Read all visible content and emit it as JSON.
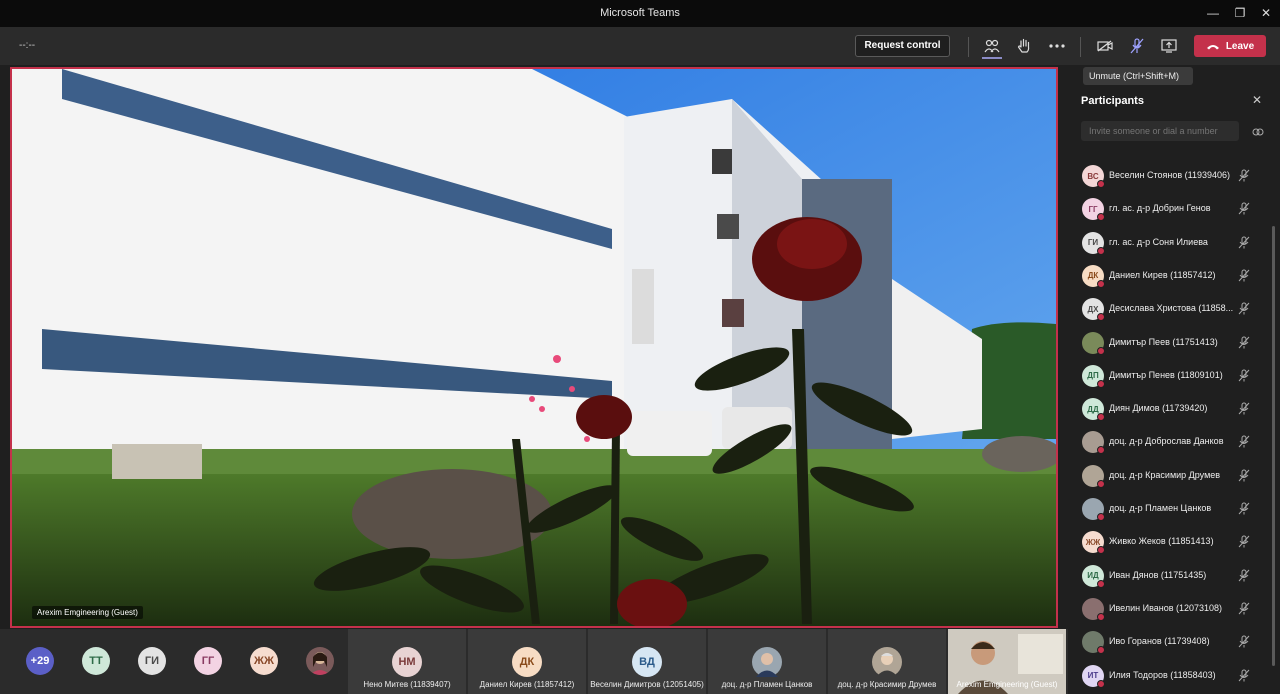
{
  "window": {
    "title": "Microsoft Teams",
    "minimize": "—",
    "maximize": "❐",
    "close": "✕"
  },
  "toolbar": {
    "timer": "--:--",
    "request_control": "Request control",
    "leave": "Leave"
  },
  "tooltip": "Unmute (Ctrl+Shift+M)",
  "video": {
    "label": "Arexim Emgineering (Guest)"
  },
  "bottom": {
    "overflow_count": "+29",
    "small_avatars": [
      {
        "initials": "ТТ",
        "bg": "#cfe8d9",
        "fg": "#2e6b48"
      },
      {
        "initials": "ГИ",
        "bg": "#e3e3e3",
        "fg": "#4a4a4a"
      },
      {
        "initials": "ГГ",
        "bg": "#f3d3e3",
        "fg": "#8a3a62"
      },
      {
        "initials": "ЖЖ",
        "bg": "#f6dccf",
        "fg": "#8a4a2a"
      }
    ],
    "tiles": [
      {
        "initials": "НМ",
        "name": "Нено Митев (11839407)",
        "bg": "#e8d3d3",
        "fg": "#7a3a3a"
      },
      {
        "initials": "ДК",
        "name": "Даниел Кирев (11857412)",
        "bg": "#f7dcc4",
        "fg": "#8a4a1a"
      },
      {
        "initials": "ВД",
        "name": "Веселин Димитров (12051405)",
        "bg": "#d6e6f3",
        "fg": "#2a5a8a"
      },
      {
        "initials": "",
        "name": "доц. д-р Пламен Цанков",
        "bg": "#9aa6b0",
        "fg": "#fff"
      },
      {
        "initials": "",
        "name": "доц. д-р Красимир Друмев",
        "bg": "#b0a596",
        "fg": "#fff"
      }
    ],
    "self_label": "Arexim Emgineering (Guest)"
  },
  "panel": {
    "title": "Participants",
    "invite_placeholder": "Invite someone or dial a number",
    "participants": [
      {
        "initials": "ВС",
        "name": "Веселин Стоянов (11939406)",
        "bg": "#f3d6d6",
        "fg": "#8a3a3a"
      },
      {
        "initials": "ГГ",
        "name": "гл. ас. д-р Добрин Генов",
        "bg": "#f3d3e3",
        "fg": "#8a3a62"
      },
      {
        "initials": "ГИ",
        "name": "гл. ас. д-р Соня Илиева",
        "bg": "#e3e3e3",
        "fg": "#4a4a4a"
      },
      {
        "initials": "ДК",
        "name": "Даниел Кирев (11857412)",
        "bg": "#f7dcc4",
        "fg": "#8a4a1a"
      },
      {
        "initials": "ДХ",
        "name": "Десислава Христова (11858...",
        "bg": "#e3e3e3",
        "fg": "#4a4a4a"
      },
      {
        "initials": "",
        "name": "Димитър Пеев (11751413)",
        "bg": "#7a8a5a",
        "fg": "#fff"
      },
      {
        "initials": "ДП",
        "name": "Димитър Пенев (11809101)",
        "bg": "#cfe8d9",
        "fg": "#2e6b48"
      },
      {
        "initials": "ДД",
        "name": "Диян Димов (11739420)",
        "bg": "#cfe8d9",
        "fg": "#2e6b48"
      },
      {
        "initials": "",
        "name": "доц. д-р Доброслав Данков",
        "bg": "#a89c92",
        "fg": "#fff"
      },
      {
        "initials": "",
        "name": "доц. д-р Красимир Друмев",
        "bg": "#b0a596",
        "fg": "#fff"
      },
      {
        "initials": "",
        "name": "доц. д-р Пламен Цанков",
        "bg": "#9aa6b0",
        "fg": "#fff"
      },
      {
        "initials": "ЖЖ",
        "name": "Живко Жеков (11851413)",
        "bg": "#f6dccf",
        "fg": "#8a4a2a"
      },
      {
        "initials": "ИД",
        "name": "Иван Дянов (11751435)",
        "bg": "#cfe8d9",
        "fg": "#2e6b48"
      },
      {
        "initials": "",
        "name": "Ивелин Иванов (12073108)",
        "bg": "#8a6f6f",
        "fg": "#fff"
      },
      {
        "initials": "",
        "name": "Иво Горанов (11739408)",
        "bg": "#6f7a6a",
        "fg": "#fff"
      },
      {
        "initials": "ИТ",
        "name": "Илия Тодоров (11858403)",
        "bg": "#e0d6f3",
        "fg": "#4a3a8a"
      }
    ]
  }
}
